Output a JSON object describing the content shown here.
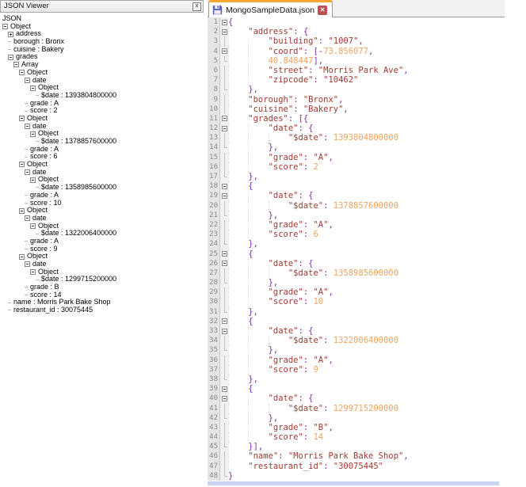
{
  "left_panel": {
    "title": "JSON Viewer",
    "close_label": "x",
    "tree": [
      {
        "indent": 0,
        "box": null,
        "label": "JSON"
      },
      {
        "indent": 0,
        "box": "minus",
        "label": "Object"
      },
      {
        "indent": 1,
        "box": "plus",
        "label": "address"
      },
      {
        "indent": 1,
        "box": null,
        "label": "borough : Bronx"
      },
      {
        "indent": 1,
        "box": null,
        "label": "cuisine : Bakery"
      },
      {
        "indent": 1,
        "box": "minus",
        "label": "grades"
      },
      {
        "indent": 2,
        "box": "minus",
        "label": "Array"
      },
      {
        "indent": 3,
        "box": "minus",
        "label": "Object"
      },
      {
        "indent": 4,
        "box": "minus",
        "label": "date"
      },
      {
        "indent": 5,
        "box": "minus",
        "label": "Object"
      },
      {
        "indent": 6,
        "box": null,
        "label": "$date : 1393804800000"
      },
      {
        "indent": 4,
        "box": null,
        "label": "grade : A"
      },
      {
        "indent": 4,
        "box": null,
        "label": "score : 2"
      },
      {
        "indent": 3,
        "box": "minus",
        "label": "Object"
      },
      {
        "indent": 4,
        "box": "minus",
        "label": "date"
      },
      {
        "indent": 5,
        "box": "minus",
        "label": "Object"
      },
      {
        "indent": 6,
        "box": null,
        "label": "$date : 1378857600000"
      },
      {
        "indent": 4,
        "box": null,
        "label": "grade : A"
      },
      {
        "indent": 4,
        "box": null,
        "label": "score : 6"
      },
      {
        "indent": 3,
        "box": "minus",
        "label": "Object"
      },
      {
        "indent": 4,
        "box": "minus",
        "label": "date"
      },
      {
        "indent": 5,
        "box": "minus",
        "label": "Object"
      },
      {
        "indent": 6,
        "box": null,
        "label": "$date : 1358985600000"
      },
      {
        "indent": 4,
        "box": null,
        "label": "grade : A"
      },
      {
        "indent": 4,
        "box": null,
        "label": "score : 10"
      },
      {
        "indent": 3,
        "box": "minus",
        "label": "Object"
      },
      {
        "indent": 4,
        "box": "minus",
        "label": "date"
      },
      {
        "indent": 5,
        "box": "minus",
        "label": "Object"
      },
      {
        "indent": 6,
        "box": null,
        "label": "$date : 1322006400000"
      },
      {
        "indent": 4,
        "box": null,
        "label": "grade : A"
      },
      {
        "indent": 4,
        "box": null,
        "label": "score : 9"
      },
      {
        "indent": 3,
        "box": "minus",
        "label": "Object"
      },
      {
        "indent": 4,
        "box": "minus",
        "label": "date"
      },
      {
        "indent": 5,
        "box": "minus",
        "label": "Object"
      },
      {
        "indent": 6,
        "box": null,
        "label": "$date : 1299715200000"
      },
      {
        "indent": 4,
        "box": null,
        "label": "grade : B"
      },
      {
        "indent": 4,
        "box": null,
        "label": "score : 14"
      },
      {
        "indent": 1,
        "box": null,
        "label": "name : Morris Park Bake Shop"
      },
      {
        "indent": 1,
        "box": null,
        "label": "restaurant_id : 30075445"
      }
    ]
  },
  "editor": {
    "tab": {
      "title": "MongoSampleData.json",
      "save_icon": "floppy-icon",
      "close_icon": "close-icon"
    },
    "colors": {
      "string": "#a13931",
      "number": "#f1a35f",
      "punct": "#7f2fa6",
      "line_number": "#8c8c8c",
      "tab_accent": "#f8a832"
    },
    "lines": [
      {
        "f": "s",
        "i": 0,
        "t": [
          [
            "p",
            "{"
          ]
        ]
      },
      {
        "f": "s",
        "i": 1,
        "t": [
          [
            "s",
            "\"address\""
          ],
          [
            "p",
            ": {"
          ]
        ]
      },
      {
        "f": "m",
        "i": 2,
        "t": [
          [
            "s",
            "\"building\""
          ],
          [
            "p",
            ": "
          ],
          [
            "s",
            "\"1007\""
          ],
          [
            "p",
            ","
          ]
        ]
      },
      {
        "f": "s",
        "i": 2,
        "t": [
          [
            "s",
            "\"coord\""
          ],
          [
            "p",
            ": [-"
          ],
          [
            "n",
            "73.856077"
          ],
          [
            "p",
            ","
          ]
        ]
      },
      {
        "f": "e",
        "i": 2,
        "t": [
          [
            "n",
            "40.848447"
          ],
          [
            "p",
            "],"
          ]
        ]
      },
      {
        "f": "m",
        "i": 2,
        "t": [
          [
            "s",
            "\"street\""
          ],
          [
            "p",
            ": "
          ],
          [
            "s",
            "\"Morris Park Ave\""
          ],
          [
            "p",
            ","
          ]
        ]
      },
      {
        "f": "m",
        "i": 2,
        "t": [
          [
            "s",
            "\"zipcode\""
          ],
          [
            "p",
            ": "
          ],
          [
            "s",
            "\"10462\""
          ]
        ]
      },
      {
        "f": "e",
        "i": 1,
        "t": [
          [
            "p",
            "},"
          ]
        ]
      },
      {
        "f": "m",
        "i": 1,
        "t": [
          [
            "s",
            "\"borough\""
          ],
          [
            "p",
            ": "
          ],
          [
            "s",
            "\"Bronx\""
          ],
          [
            "p",
            ","
          ]
        ]
      },
      {
        "f": "m",
        "i": 1,
        "t": [
          [
            "s",
            "\"cuisine\""
          ],
          [
            "p",
            ": "
          ],
          [
            "s",
            "\"Bakery\""
          ],
          [
            "p",
            ","
          ]
        ]
      },
      {
        "f": "s",
        "i": 1,
        "t": [
          [
            "s",
            "\"grades\""
          ],
          [
            "p",
            ": [{"
          ]
        ]
      },
      {
        "f": "s",
        "i": 2,
        "t": [
          [
            "s",
            "\"date\""
          ],
          [
            "p",
            ": {"
          ]
        ]
      },
      {
        "f": "m",
        "i": 3,
        "t": [
          [
            "s",
            "\"$date\""
          ],
          [
            "p",
            ": "
          ],
          [
            "n",
            "1393804800000"
          ]
        ]
      },
      {
        "f": "e",
        "i": 2,
        "t": [
          [
            "p",
            "},"
          ]
        ]
      },
      {
        "f": "m",
        "i": 2,
        "t": [
          [
            "s",
            "\"grade\""
          ],
          [
            "p",
            ": "
          ],
          [
            "s",
            "\"A\""
          ],
          [
            "p",
            ","
          ]
        ]
      },
      {
        "f": "m",
        "i": 2,
        "t": [
          [
            "s",
            "\"score\""
          ],
          [
            "p",
            ": "
          ],
          [
            "n",
            "2"
          ]
        ]
      },
      {
        "f": "e",
        "i": 1,
        "t": [
          [
            "p",
            "},"
          ]
        ]
      },
      {
        "f": "s",
        "i": 1,
        "t": [
          [
            "p",
            "{"
          ]
        ]
      },
      {
        "f": "s",
        "i": 2,
        "t": [
          [
            "s",
            "\"date\""
          ],
          [
            "p",
            ": {"
          ]
        ]
      },
      {
        "f": "m",
        "i": 3,
        "t": [
          [
            "s",
            "\"$date\""
          ],
          [
            "p",
            ": "
          ],
          [
            "n",
            "1378857600000"
          ]
        ]
      },
      {
        "f": "e",
        "i": 2,
        "t": [
          [
            "p",
            "},"
          ]
        ]
      },
      {
        "f": "m",
        "i": 2,
        "t": [
          [
            "s",
            "\"grade\""
          ],
          [
            "p",
            ": "
          ],
          [
            "s",
            "\"A\""
          ],
          [
            "p",
            ","
          ]
        ]
      },
      {
        "f": "m",
        "i": 2,
        "t": [
          [
            "s",
            "\"score\""
          ],
          [
            "p",
            ": "
          ],
          [
            "n",
            "6"
          ]
        ]
      },
      {
        "f": "e",
        "i": 1,
        "t": [
          [
            "p",
            "},"
          ]
        ]
      },
      {
        "f": "s",
        "i": 1,
        "t": [
          [
            "p",
            "{"
          ]
        ]
      },
      {
        "f": "s",
        "i": 2,
        "t": [
          [
            "s",
            "\"date\""
          ],
          [
            "p",
            ": {"
          ]
        ]
      },
      {
        "f": "m",
        "i": 3,
        "t": [
          [
            "s",
            "\"$date\""
          ],
          [
            "p",
            ": "
          ],
          [
            "n",
            "1358985600000"
          ]
        ]
      },
      {
        "f": "e",
        "i": 2,
        "t": [
          [
            "p",
            "},"
          ]
        ]
      },
      {
        "f": "m",
        "i": 2,
        "t": [
          [
            "s",
            "\"grade\""
          ],
          [
            "p",
            ": "
          ],
          [
            "s",
            "\"A\""
          ],
          [
            "p",
            ","
          ]
        ]
      },
      {
        "f": "m",
        "i": 2,
        "t": [
          [
            "s",
            "\"score\""
          ],
          [
            "p",
            ": "
          ],
          [
            "n",
            "10"
          ]
        ]
      },
      {
        "f": "e",
        "i": 1,
        "t": [
          [
            "p",
            "},"
          ]
        ]
      },
      {
        "f": "s",
        "i": 1,
        "t": [
          [
            "p",
            "{"
          ]
        ]
      },
      {
        "f": "s",
        "i": 2,
        "t": [
          [
            "s",
            "\"date\""
          ],
          [
            "p",
            ": {"
          ]
        ]
      },
      {
        "f": "m",
        "i": 3,
        "t": [
          [
            "s",
            "\"$date\""
          ],
          [
            "p",
            ": "
          ],
          [
            "n",
            "1322006400000"
          ]
        ]
      },
      {
        "f": "e",
        "i": 2,
        "t": [
          [
            "p",
            "},"
          ]
        ]
      },
      {
        "f": "m",
        "i": 2,
        "t": [
          [
            "s",
            "\"grade\""
          ],
          [
            "p",
            ": "
          ],
          [
            "s",
            "\"A\""
          ],
          [
            "p",
            ","
          ]
        ]
      },
      {
        "f": "m",
        "i": 2,
        "t": [
          [
            "s",
            "\"score\""
          ],
          [
            "p",
            ": "
          ],
          [
            "n",
            "9"
          ]
        ]
      },
      {
        "f": "e",
        "i": 1,
        "t": [
          [
            "p",
            "},"
          ]
        ]
      },
      {
        "f": "s",
        "i": 1,
        "t": [
          [
            "p",
            "{"
          ]
        ]
      },
      {
        "f": "s",
        "i": 2,
        "t": [
          [
            "s",
            "\"date\""
          ],
          [
            "p",
            ": {"
          ]
        ]
      },
      {
        "f": "m",
        "i": 3,
        "t": [
          [
            "s",
            "\"$date\""
          ],
          [
            "p",
            ": "
          ],
          [
            "n",
            "1299715200000"
          ]
        ]
      },
      {
        "f": "e",
        "i": 2,
        "t": [
          [
            "p",
            "},"
          ]
        ]
      },
      {
        "f": "m",
        "i": 2,
        "t": [
          [
            "s",
            "\"grade\""
          ],
          [
            "p",
            ": "
          ],
          [
            "s",
            "\"B\""
          ],
          [
            "p",
            ","
          ]
        ]
      },
      {
        "f": "m",
        "i": 2,
        "t": [
          [
            "s",
            "\"score\""
          ],
          [
            "p",
            ": "
          ],
          [
            "n",
            "14"
          ]
        ]
      },
      {
        "f": "e",
        "i": 1,
        "t": [
          [
            "p",
            "}],"
          ]
        ]
      },
      {
        "f": "m",
        "i": 1,
        "t": [
          [
            "s",
            "\"name\""
          ],
          [
            "p",
            ": "
          ],
          [
            "s",
            "\"Morris Park Bake Shop\""
          ],
          [
            "p",
            ","
          ]
        ]
      },
      {
        "f": "m",
        "i": 1,
        "t": [
          [
            "s",
            "\"restaurant_id\""
          ],
          [
            "p",
            ": "
          ],
          [
            "s",
            "\"30075445\""
          ]
        ]
      },
      {
        "f": "e",
        "i": 0,
        "t": [
          [
            "p",
            "}"
          ]
        ]
      }
    ]
  }
}
